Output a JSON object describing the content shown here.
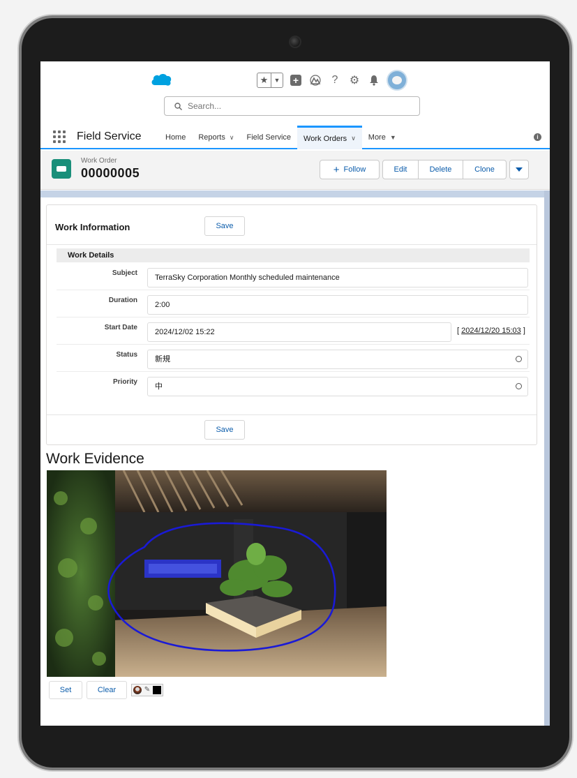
{
  "header": {
    "search_placeholder": "Search...",
    "icons": [
      "salesforce-cloud-logo",
      "favorite-star-icon",
      "add-icon",
      "trailhead-icon",
      "help-icon",
      "setup-gear-icon",
      "notification-bell-icon",
      "user-avatar"
    ]
  },
  "nav": {
    "app_name": "Field Service",
    "items": [
      {
        "label": "Home",
        "dropdown": false
      },
      {
        "label": "Reports",
        "dropdown": true
      },
      {
        "label": "Field Service",
        "dropdown": false
      },
      {
        "label": "Work Orders",
        "dropdown": true,
        "active": true
      },
      {
        "label": "More",
        "dropdown": true
      }
    ],
    "chevron": "∨",
    "more_caret": "▼"
  },
  "record": {
    "type": "Work Order",
    "name": "00000005",
    "actions": {
      "follow": "Follow",
      "edit": "Edit",
      "delete": "Delete",
      "clone": "Clone"
    }
  },
  "work_information": {
    "title": "Work Information",
    "save_label": "Save",
    "section_title": "Work Details",
    "fields": {
      "subject": {
        "label": "Subject",
        "value": "TerraSky Corporation Monthly scheduled maintenance"
      },
      "duration": {
        "label": "Duration",
        "value": "2:00"
      },
      "start_date": {
        "label": "Start Date",
        "value": "2024/12/02 15:22",
        "now_link": "2024/12/20 15:03",
        "bracket_open": "[",
        "bracket_close": "]"
      },
      "status": {
        "label": "Status",
        "value": "新規"
      },
      "priority": {
        "label": "Priority",
        "value": "中"
      }
    }
  },
  "evidence": {
    "title": "Work Evidence",
    "set_label": "Set",
    "clear_label": "Clear",
    "annotation_color": "#1a1ad6"
  },
  "colors": {
    "accent": "#1b96ff",
    "link": "#0b5cab",
    "record_icon": "#1a8f7a",
    "band": "#c5d3e6"
  }
}
